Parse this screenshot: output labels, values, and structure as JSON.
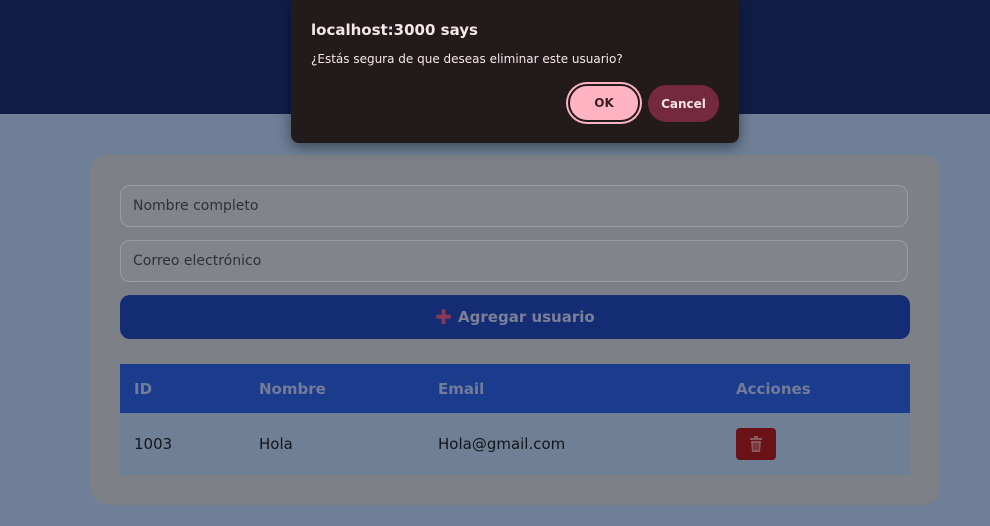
{
  "dialog": {
    "title": "localhost:3000 says",
    "message": "¿Estás segura de que deseas eliminar este usuario?",
    "ok_label": "OK",
    "cancel_label": "Cancel"
  },
  "form": {
    "name_placeholder": "Nombre completo",
    "email_placeholder": "Correo electrónico",
    "add_button_label": "Agregar usuario",
    "add_icon": "plus-icon"
  },
  "table": {
    "headers": [
      "ID",
      "Nombre",
      "Email",
      "Acciones"
    ],
    "rows": [
      {
        "id": "1003",
        "name": "Hola",
        "email": "Hola@gmail.com",
        "action_icon": "trash-icon"
      }
    ]
  },
  "colors": {
    "header": "#101e47",
    "accent_blue": "#1b3b8c",
    "delete_red": "#6b1218",
    "dialog_bg": "#231a1c",
    "ok_button": "#ffb3c3",
    "cancel_button": "#74293e"
  }
}
